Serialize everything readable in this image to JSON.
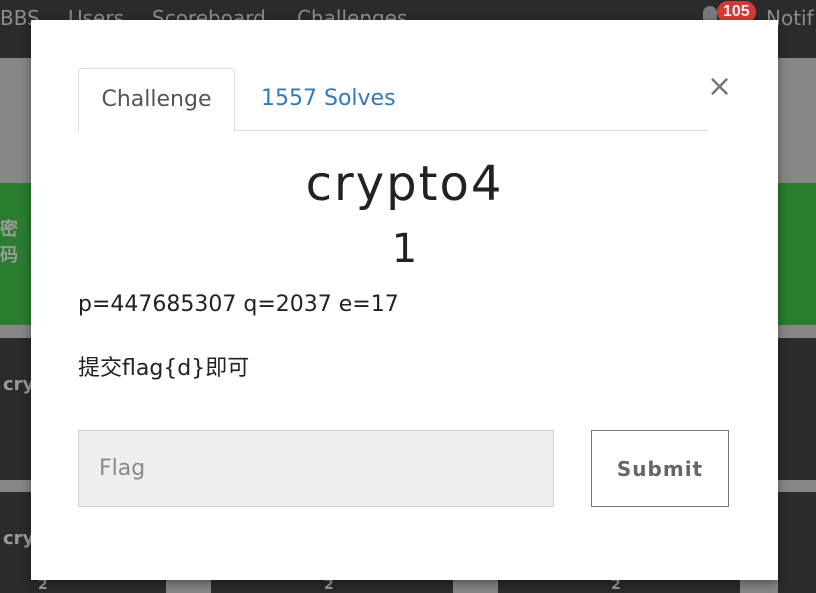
{
  "nav": {
    "items": [
      "BBS",
      "Users",
      "Scoreboard",
      "Challenges"
    ],
    "notifications_count": "105",
    "notifications_label": "Notif"
  },
  "background": {
    "card_label_green": "密码",
    "card_label_1": "cry",
    "card_label_2": "cry",
    "bottom_values": [
      "2",
      "2",
      "2"
    ]
  },
  "modal": {
    "tabs": {
      "challenge": "Challenge",
      "solves": "1557 Solves"
    },
    "close_symbol": "×",
    "title": "crypto4",
    "value": "1",
    "description_line1": "p=447685307 q=2037 e=17",
    "description_line2": "提交flag{d}即可",
    "flag_placeholder": "Flag",
    "flag_value": "",
    "submit_label": "Submit"
  },
  "colors": {
    "accent_link": "#337ab7",
    "badge": "#d43a33",
    "card_green": "#2a7d2e"
  }
}
